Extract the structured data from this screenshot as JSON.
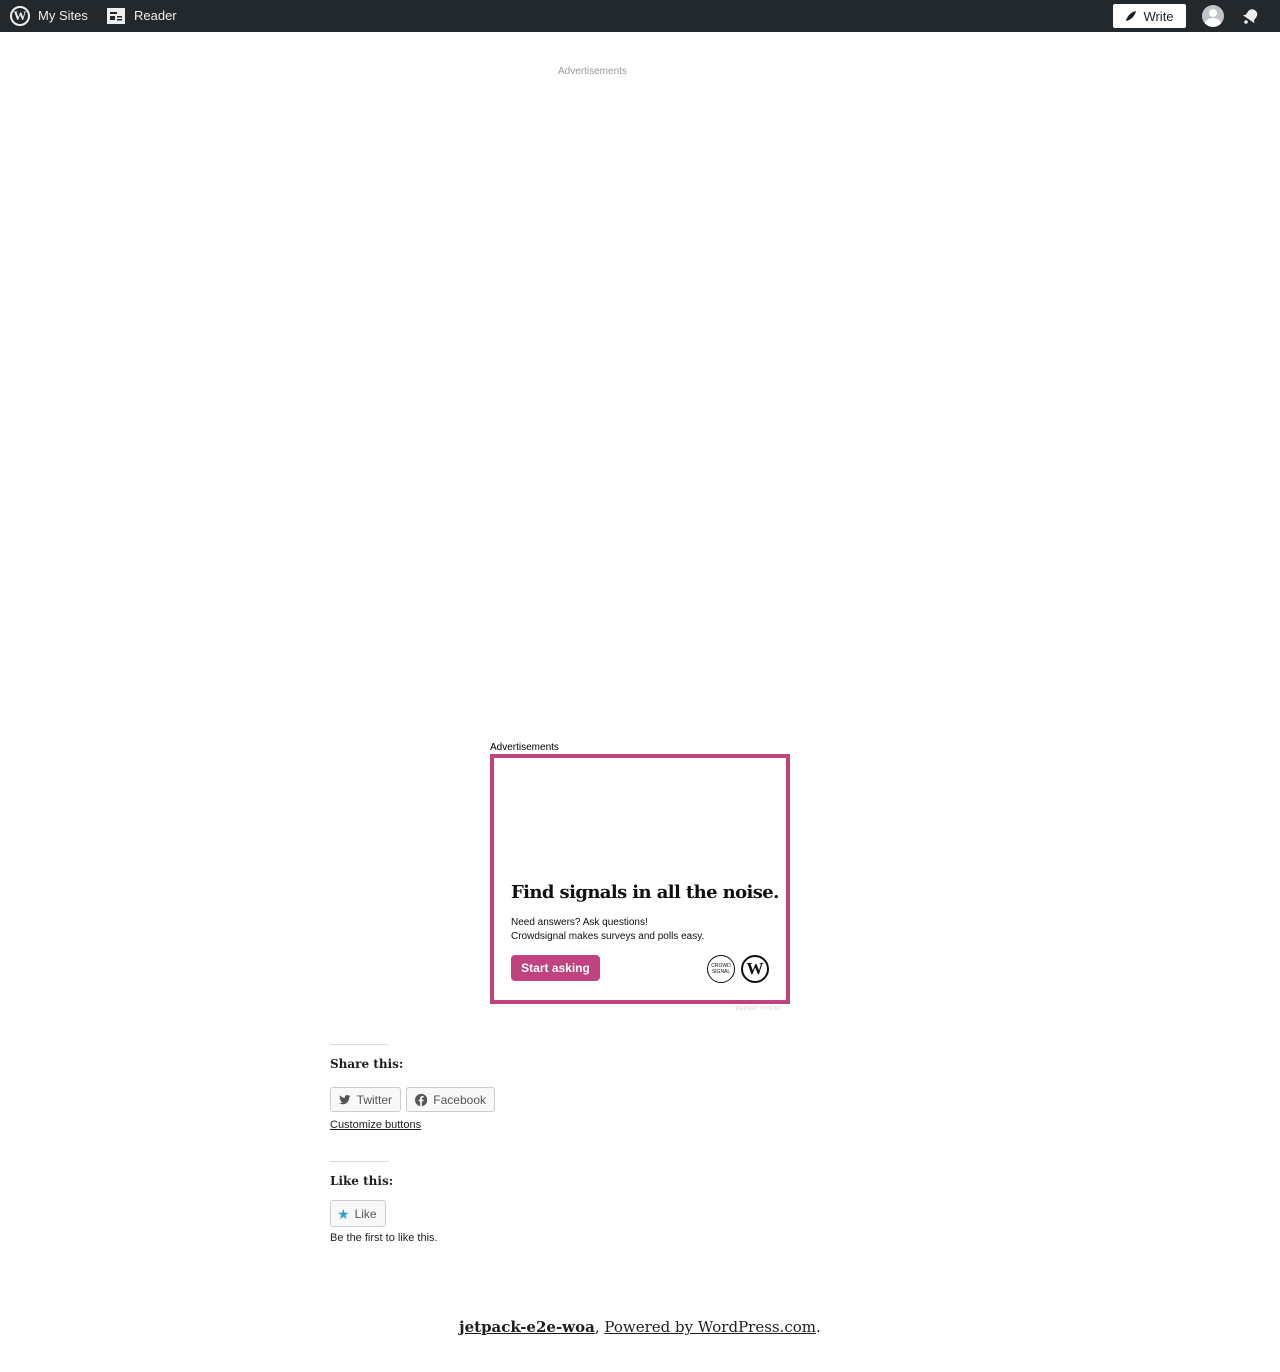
{
  "admin_bar": {
    "my_sites_label": "My Sites",
    "reader_label": "Reader",
    "write_label": "Write"
  },
  "ads": {
    "top_label": "Advertisements",
    "mid_label": "Advertisements",
    "headline": "Find signals in all the noise.",
    "body_line1": "Need answers? Ask questions!",
    "body_line2": "Crowdsignal makes surveys and polls easy.",
    "cta_label": "Start asking",
    "crowdsignal_logo_text": "CROWD SIGNAL",
    "report_label": "REPORT THIS AD",
    "accent_color": "#c0427e"
  },
  "share": {
    "title": "Share this:",
    "twitter_label": "Twitter",
    "facebook_label": "Facebook",
    "customize_label": "Customize buttons"
  },
  "likes": {
    "title": "Like this:",
    "like_label": "Like",
    "first_text": "Be the first to like this."
  },
  "footer": {
    "site_name": "jetpack-e2e-woa",
    "separator": ",",
    "powered_by": "Powered by WordPress.com",
    "end": "."
  }
}
